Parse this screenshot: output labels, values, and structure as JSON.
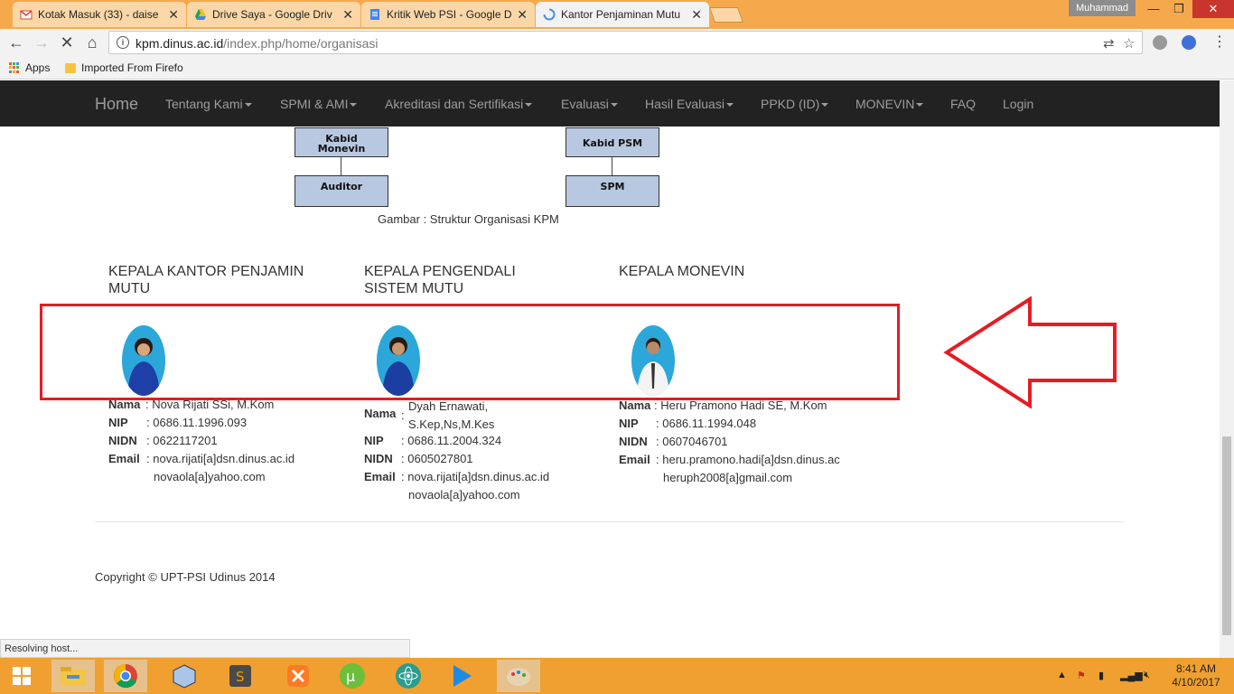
{
  "browser": {
    "tabs": [
      {
        "title": "Kotak Masuk (33) - daise",
        "icon": "gmail-icon",
        "color": "#d44638"
      },
      {
        "title": "Drive Saya - Google Driv",
        "icon": "google-drive-icon",
        "color": "#1da462"
      },
      {
        "title": "Kritik Web PSI - Google D",
        "icon": "google-docs-icon",
        "color": "#4285f4"
      },
      {
        "title": "Kantor Penjaminan Mutu",
        "icon": "loading-spinner-icon",
        "color": "#4a90e2"
      }
    ],
    "user": "Muhammad",
    "url_host": "kpm.dinus.ac.id",
    "url_path": "/index.php/home/organisasi",
    "bookmarks": {
      "apps": "Apps",
      "imported": "Imported From Firefo"
    }
  },
  "site": {
    "brand": "Home",
    "nav": [
      {
        "label": "Tentang Kami",
        "dropdown": true
      },
      {
        "label": "SPMI & AMI",
        "dropdown": true
      },
      {
        "label": "Akreditasi dan Sertifikasi",
        "dropdown": true
      },
      {
        "label": "Evaluasi",
        "dropdown": true
      },
      {
        "label": "Hasil Evaluasi",
        "dropdown": true
      },
      {
        "label": "PPKD (ID)",
        "dropdown": true
      },
      {
        "label": "MONEVIN",
        "dropdown": true
      },
      {
        "label": "FAQ",
        "dropdown": false
      },
      {
        "label": "Login",
        "dropdown": false
      }
    ]
  },
  "org_chart": {
    "kabid_monevin": "Kabid\nMonevin",
    "kabid_psm": "Kabid PSM",
    "auditor": "Auditor",
    "spm": "SPM",
    "caption": "Gambar : Struktur Organisasi KPM"
  },
  "people": [
    {
      "heading": "KEPALA  KANTOR  PENJAMIN MUTU",
      "name_label": "Nama",
      "name": "Nova Rijati SSi, M.Kom",
      "nip_label": "NIP",
      "nip": "0686.11.1996.093",
      "nidn_label": "NIDN",
      "nidn": "0622117201",
      "email_label": "Email",
      "email1": "nova.rijati[a]dsn.dinus.ac.id",
      "email2": "novaola[a]yahoo.com"
    },
    {
      "heading": "KEPALA PENGENDALI SISTEM MUTU",
      "name_label": "Nama",
      "name": "Dyah Ernawati, S.Kep,Ns,M.Kes",
      "nip_label": "NIP",
      "nip": "0686.11.2004.324",
      "nidn_label": "NIDN",
      "nidn": "0605027801",
      "email_label": "Email",
      "email1": "nova.rijati[a]dsn.dinus.ac.id",
      "email2": "novaola[a]yahoo.com"
    },
    {
      "heading": "KEPALA MONEVIN",
      "name_label": "Nama",
      "name": "Heru Pramono Hadi SE, M.Kom",
      "nip_label": "NIP",
      "nip": "0686.11.1994.048",
      "nidn_label": "NIDN",
      "nidn": "0607046701",
      "email_label": "Email",
      "email1": "heru.pramono.hadi[a]dsn.dinus.ac",
      "email2": "heruph2008[a]gmail.com"
    }
  ],
  "footer": {
    "copyright": "Copyright © UPT-PSI Udinus 2014"
  },
  "status_bar": "Resolving host...",
  "taskbar": {
    "apps": [
      "windows-start-icon",
      "file-explorer-icon",
      "chrome-icon",
      "virtualbox-icon",
      "sublime-text-icon",
      "xampp-icon",
      "utorrent-icon",
      "atom-icon",
      "media-player-icon",
      "paint-icon"
    ],
    "time": "8:41 AM",
    "date": "4/10/2017"
  },
  "annotation": {
    "highlight_color": "#e51c23"
  }
}
